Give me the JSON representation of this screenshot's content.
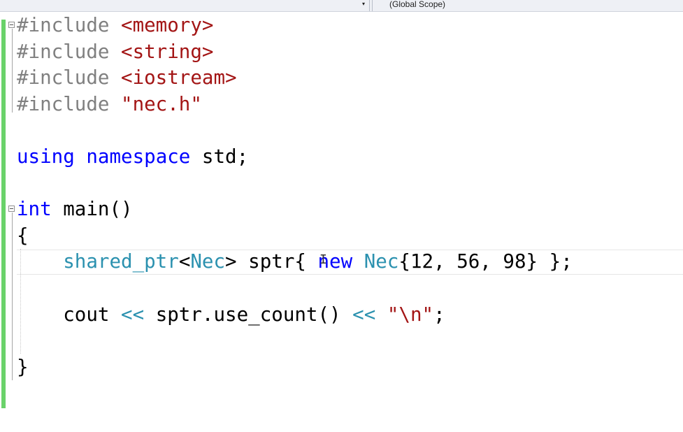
{
  "navbar": {
    "scope_label": "(Global Scope)",
    "dropdown_arrow": "▾"
  },
  "editor": {
    "lines": [
      {
        "tokens": [
          {
            "t": "#include ",
            "k": "pre"
          },
          {
            "t": "<memory>",
            "k": "str"
          }
        ]
      },
      {
        "tokens": [
          {
            "t": "#include ",
            "k": "pre"
          },
          {
            "t": "<string>",
            "k": "str"
          }
        ]
      },
      {
        "tokens": [
          {
            "t": "#include ",
            "k": "pre"
          },
          {
            "t": "<iostream>",
            "k": "str"
          }
        ]
      },
      {
        "tokens": [
          {
            "t": "#include ",
            "k": "pre"
          },
          {
            "t": "\"nec.h\"",
            "k": "str"
          }
        ]
      },
      {
        "tokens": []
      },
      {
        "tokens": [
          {
            "t": "using",
            "k": "kw"
          },
          {
            "t": " ",
            "k": "txt"
          },
          {
            "t": "namespace",
            "k": "kw"
          },
          {
            "t": " std;",
            "k": "txt"
          }
        ]
      },
      {
        "tokens": []
      },
      {
        "tokens": [
          {
            "t": "int",
            "k": "kw"
          },
          {
            "t": " main()",
            "k": "txt"
          }
        ]
      },
      {
        "tokens": [
          {
            "t": "{",
            "k": "txt"
          }
        ]
      },
      {
        "tokens": [
          {
            "t": "    ",
            "k": "txt"
          },
          {
            "t": "shared_ptr",
            "k": "type"
          },
          {
            "t": "<",
            "k": "txt"
          },
          {
            "t": "Nec",
            "k": "type"
          },
          {
            "t": "> sptr{ ",
            "k": "txt"
          },
          {
            "t": "new",
            "k": "kw"
          },
          {
            "t": " ",
            "k": "txt"
          },
          {
            "t": "Nec",
            "k": "type"
          },
          {
            "t": "{12, 56, 98} };",
            "k": "txt"
          }
        ]
      },
      {
        "tokens": []
      },
      {
        "tokens": [
          {
            "t": "    cout ",
            "k": "txt"
          },
          {
            "t": "<<",
            "k": "type"
          },
          {
            "t": " sptr.use_count() ",
            "k": "txt"
          },
          {
            "t": "<<",
            "k": "type"
          },
          {
            "t": " ",
            "k": "txt"
          },
          {
            "t": "\"\\n\"",
            "k": "str"
          },
          {
            "t": ";",
            "k": "txt"
          }
        ]
      },
      {
        "tokens": []
      },
      {
        "tokens": [
          {
            "t": "}",
            "k": "txt"
          }
        ]
      }
    ],
    "caret_glyph": "I"
  },
  "colors": {
    "preprocessor": "#808080",
    "string": "#a31515",
    "keyword": "#0000ff",
    "type": "#2b91af",
    "change_margin": "#6ad26a"
  }
}
